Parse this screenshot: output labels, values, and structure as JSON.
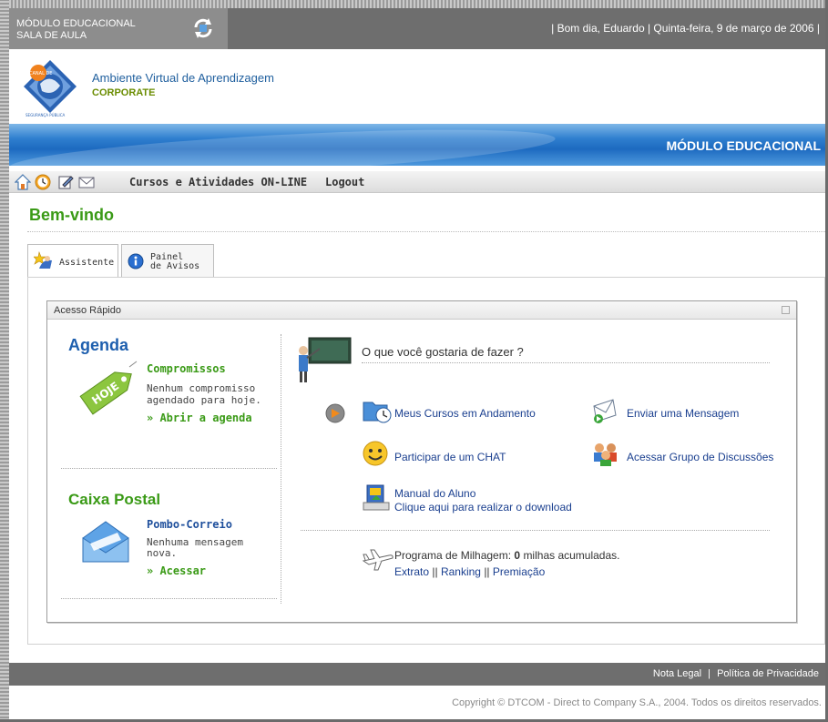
{
  "header": {
    "module_line1": "MÓDULO EDUCACIONAL",
    "module_line2": "SALA DE AULA",
    "greeting": "| Bom dia, Eduardo | Quinta-feira, 9 de março de 2006 |"
  },
  "brand": {
    "title": "Ambiente Virtual de Aprendizagem",
    "subtitle": "CORPORATE",
    "logo_text_top": "CANAL DE",
    "logo_text_bottom": "SEGURANÇA PÚBLICA"
  },
  "banner": {
    "title": "MÓDULO EDUCACIONAL"
  },
  "nav": {
    "courses": "Cursos e Atividades ON-LINE",
    "logout": "Logout",
    "icons": [
      "home-icon",
      "clock-icon",
      "notepad-icon",
      "mail-icon"
    ]
  },
  "page": {
    "title": "Bem-vindo"
  },
  "tabs": [
    {
      "label": "Assistente"
    },
    {
      "label_line1": "Painel",
      "label_line2": "de Avisos"
    }
  ],
  "quick_access": {
    "title": "Acesso Rápido",
    "agenda": {
      "heading": "Agenda",
      "badge": "HOJE",
      "label": "Compromissos",
      "text_line1": "Nenhum compromisso",
      "text_line2": "agendado para hoje.",
      "link": "» Abrir a agenda"
    },
    "mailbox": {
      "heading": "Caixa Postal",
      "label": "Pombo-Correio",
      "text_line1": "Nenhuma mensagem",
      "text_line2": "nova.",
      "link": "» Acessar"
    },
    "prompt": "O que você gostaria de fazer ?",
    "actions": {
      "courses": "Meus Cursos em Andamento",
      "message": "Enviar uma Mensagem",
      "chat": "Participar de um CHAT",
      "group": "Acessar Grupo de Discussões",
      "manual_title": "Manual do Aluno",
      "manual_download": "Clique aqui para realizar o download"
    },
    "mileage": {
      "prefix": "Programa de Milhagem:",
      "value": "0",
      "suffix": "milhas acumuladas.",
      "extrato": "Extrato",
      "ranking": "Ranking",
      "premiacao": "Premiação"
    }
  },
  "footer": {
    "legal": "Nota Legal",
    "privacy": "Política de Privacidade",
    "copyright": "Copyright © DTCOM - Direct to Company S.A., 2004. Todos os direitos reservados."
  },
  "colors": {
    "green": "#3a9a16",
    "blue_heading": "#1e5fae",
    "link": "#1a3f8f",
    "bar_gray": "#6e6e6e"
  }
}
